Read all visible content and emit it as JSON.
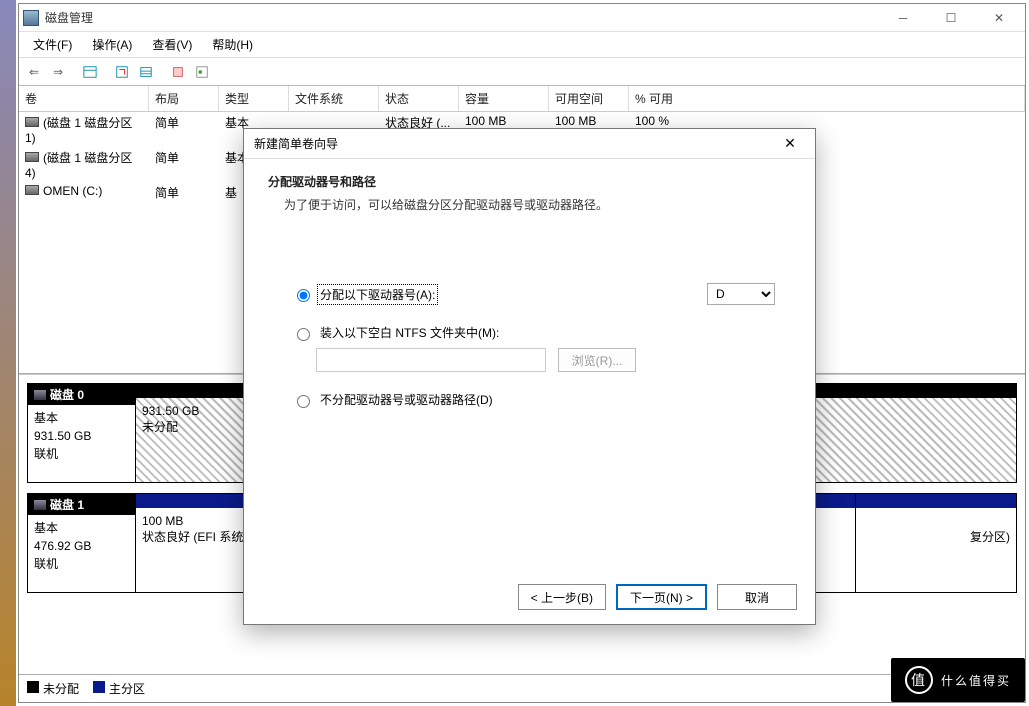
{
  "window": {
    "title": "磁盘管理"
  },
  "menu": {
    "file": "文件(F)",
    "action": "操作(A)",
    "view": "查看(V)",
    "help": "帮助(H)"
  },
  "columns": {
    "vol": "卷",
    "layout": "布局",
    "type": "类型",
    "fs": "文件系统",
    "status": "状态",
    "cap": "容量",
    "free": "可用空间",
    "pct": "% 可用"
  },
  "rows": [
    {
      "vol": "(磁盘 1 磁盘分区 1)",
      "layout": "简单",
      "type": "基本",
      "fs": "",
      "status": "状态良好 (...",
      "cap": "100 MB",
      "free": "100 MB",
      "pct": "100 %"
    },
    {
      "vol": "(磁盘 1 磁盘分区 4)",
      "layout": "简单",
      "type": "基本",
      "fs": "",
      "status": "",
      "cap": "",
      "free": "",
      "pct": ""
    },
    {
      "vol": "OMEN (C:)",
      "layout": "简单",
      "type": "基",
      "fs": "",
      "status": "",
      "cap": "",
      "free": "",
      "pct": ""
    }
  ],
  "disk0": {
    "name": "磁盘 0",
    "type": "基本",
    "size": "931.50 GB",
    "state": "联机",
    "part": {
      "size": "931.50 GB",
      "desc": "未分配"
    }
  },
  "disk1": {
    "name": "磁盘 1",
    "type": "基本",
    "size": "476.92 GB",
    "state": "联机",
    "p1": {
      "size": "100 MB",
      "desc": "状态良好 (EFI 系统"
    },
    "p4": {
      "desc": "复分区)"
    }
  },
  "legend": {
    "unalloc": "未分配",
    "primary": "主分区"
  },
  "dialog": {
    "title": "新建简单卷向导",
    "heading": "分配驱动器号和路径",
    "sub": "为了便于访问，可以给磁盘分区分配驱动器号或驱动器路径。",
    "opt1": "分配以下驱动器号(A):",
    "drive": "D",
    "opt2": "装入以下空白 NTFS 文件夹中(M):",
    "browse": "浏览(R)...",
    "opt3": "不分配驱动器号或驱动器路径(D)",
    "back": "< 上一步(B)",
    "next": "下一页(N) >",
    "cancel": "取消"
  },
  "watermark": "什么值得买"
}
